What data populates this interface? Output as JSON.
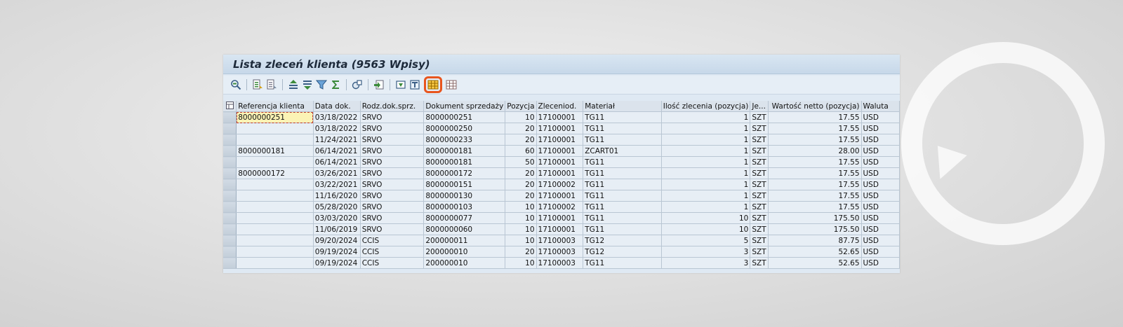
{
  "window": {
    "title": "Lista zleceń klienta (9563 Wpisy)"
  },
  "toolbar": {
    "buttons": [
      {
        "icon": "detail-icon"
      },
      {
        "icon": "sort-ascending-icon"
      },
      {
        "icon": "sort-descending-icon"
      },
      {
        "icon": "find-icon"
      },
      {
        "icon": "find-next-icon"
      },
      {
        "icon": "filter-icon"
      },
      {
        "icon": "total-icon"
      },
      {
        "icon": "views-icon"
      },
      {
        "icon": "export-icon"
      },
      {
        "icon": "print-icon"
      },
      {
        "icon": "layout-icon"
      },
      {
        "icon": "choose-layout-icon"
      },
      {
        "icon": "grid-icon"
      }
    ],
    "highlight_color": "#e8551e"
  },
  "table": {
    "columns": [
      "Referencja klienta",
      "Data dok.",
      "Rodz.dok.sprz.",
      "Dokument sprzedaży",
      "Pozycja",
      "Zleceniod.",
      "Materiał",
      "Ilość zlecenia (pozycja)",
      "Je...",
      "Wartość netto (pozycja)",
      "Waluta"
    ],
    "rows": [
      [
        "8000000251",
        "03/18/2022",
        "SRVO",
        "8000000251",
        "10",
        "17100001",
        "TG11",
        "1",
        "SZT",
        "17.55",
        "USD"
      ],
      [
        "",
        "03/18/2022",
        "SRVO",
        "8000000250",
        "20",
        "17100001",
        "TG11",
        "1",
        "SZT",
        "17.55",
        "USD"
      ],
      [
        "",
        "11/24/2021",
        "SRVO",
        "8000000233",
        "20",
        "17100001",
        "TG11",
        "1",
        "SZT",
        "17.55",
        "USD"
      ],
      [
        "8000000181",
        "06/14/2021",
        "SRVO",
        "8000000181",
        "60",
        "17100001",
        "ZCART01",
        "1",
        "SZT",
        "28.00",
        "USD"
      ],
      [
        "",
        "06/14/2021",
        "SRVO",
        "8000000181",
        "50",
        "17100001",
        "TG11",
        "1",
        "SZT",
        "17.55",
        "USD"
      ],
      [
        "8000000172",
        "03/26/2021",
        "SRVO",
        "8000000172",
        "20",
        "17100001",
        "TG11",
        "1",
        "SZT",
        "17.55",
        "USD"
      ],
      [
        "",
        "03/22/2021",
        "SRVO",
        "8000000151",
        "20",
        "17100002",
        "TG11",
        "1",
        "SZT",
        "17.55",
        "USD"
      ],
      [
        "",
        "11/16/2020",
        "SRVO",
        "8000000130",
        "20",
        "17100001",
        "TG11",
        "1",
        "SZT",
        "17.55",
        "USD"
      ],
      [
        "",
        "05/28/2020",
        "SRVO",
        "8000000103",
        "10",
        "17100002",
        "TG11",
        "1",
        "SZT",
        "17.55",
        "USD"
      ],
      [
        "",
        "03/03/2020",
        "SRVO",
        "8000000077",
        "10",
        "17100001",
        "TG11",
        "10",
        "SZT",
        "175.50",
        "USD"
      ],
      [
        "",
        "11/06/2019",
        "SRVO",
        "8000000060",
        "10",
        "17100001",
        "TG11",
        "10",
        "SZT",
        "175.50",
        "USD"
      ],
      [
        "",
        "09/20/2024",
        "CCIS",
        "200000011",
        "10",
        "17100003",
        "TG12",
        "5",
        "SZT",
        "87.75",
        "USD"
      ],
      [
        "",
        "09/19/2024",
        "CCIS",
        "200000010",
        "20",
        "17100003",
        "TG12",
        "3",
        "SZT",
        "52.65",
        "USD"
      ],
      [
        "",
        "09/19/2024",
        "CCIS",
        "200000010",
        "10",
        "17100003",
        "TG11",
        "3",
        "SZT",
        "52.65",
        "USD"
      ]
    ]
  }
}
